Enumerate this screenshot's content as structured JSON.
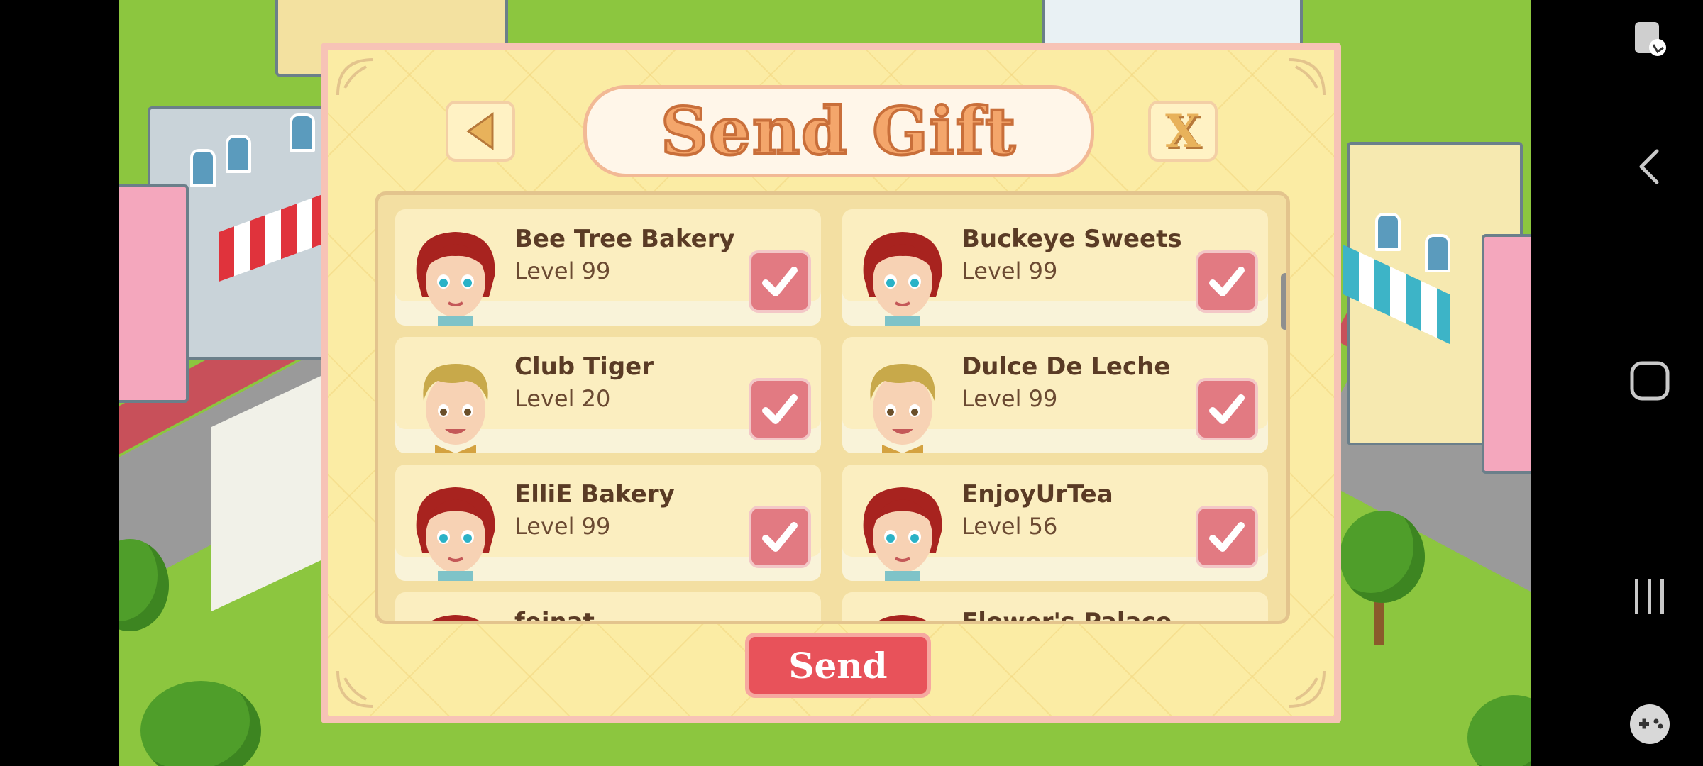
{
  "dialog": {
    "title": "Send Gift",
    "close_label": "X",
    "send_label": "Send"
  },
  "friends": [
    {
      "name": "Bee Tree Bakery",
      "level": "Level 99",
      "avatar": "girl-chef-avatar",
      "checked": true
    },
    {
      "name": "Buckeye Sweets",
      "level": "Level 99",
      "avatar": "girl-chef-avatar",
      "checked": true
    },
    {
      "name": "Club Tiger",
      "level": "Level 20",
      "avatar": "boy-chef-avatar",
      "checked": true
    },
    {
      "name": "Dulce De Leche",
      "level": "Level 99",
      "avatar": "boy-chef-avatar",
      "checked": true
    },
    {
      "name": "ElliE Bakery",
      "level": "Level 99",
      "avatar": "girl-chef-avatar",
      "checked": true
    },
    {
      "name": "EnjoyUrTea",
      "level": "Level 56",
      "avatar": "girl-chef-avatar",
      "checked": true
    },
    {
      "name": "feinat",
      "level": "",
      "avatar": "girl-chef-avatar",
      "checked": false
    },
    {
      "name": "Flower's Palace",
      "level": "",
      "avatar": "girl-chef-avatar",
      "checked": false
    }
  ],
  "colors": {
    "panel": "#fbeca4",
    "send": "#e8525a",
    "checkbox": "#e27a82",
    "title": "#f4a66b"
  },
  "nav_icons": [
    "screen-lock-icon",
    "back-arrow-icon",
    "home-square-icon",
    "recent-apps-icon",
    "game-controller-icon"
  ]
}
